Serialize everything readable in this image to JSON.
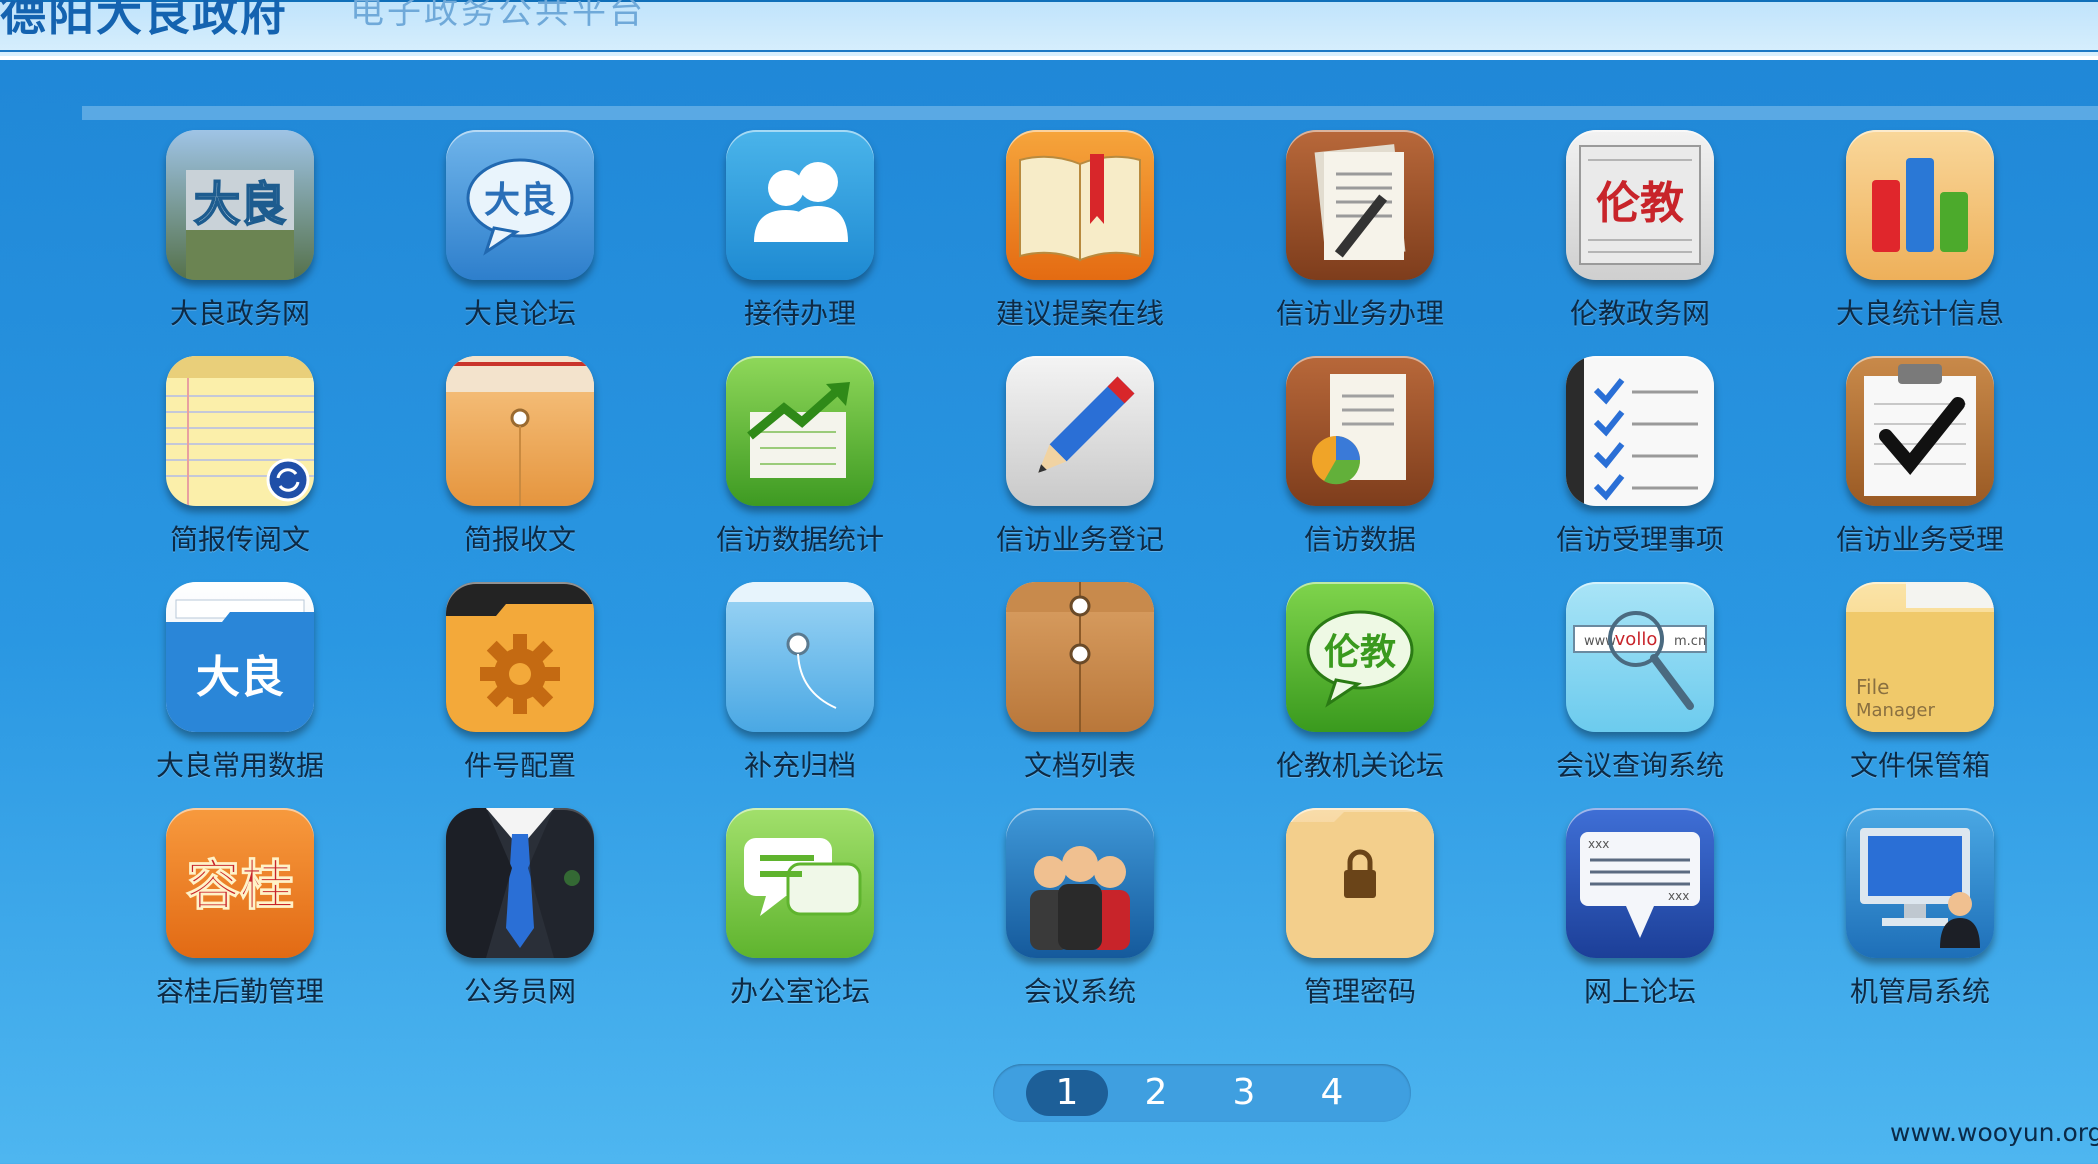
{
  "header": {
    "title": "德阳大良政府",
    "subtitle": "电子政务公共平台"
  },
  "apps": [
    {
      "label": "大良政务网",
      "icon": "daliang-building-icon"
    },
    {
      "label": "大良论坛",
      "icon": "daliang-chat-bubble-icon"
    },
    {
      "label": "接待办理",
      "icon": "users-icon"
    },
    {
      "label": "建议提案在线",
      "icon": "open-book-icon"
    },
    {
      "label": "信访业务办理",
      "icon": "document-pen-icon"
    },
    {
      "label": "伦教政务网",
      "icon": "lunjiao-newspaper-icon"
    },
    {
      "label": "大良统计信息",
      "icon": "bar-chart-icon"
    },
    {
      "label": "简报传阅文",
      "icon": "notepad-sync-icon"
    },
    {
      "label": "简报收文",
      "icon": "envelope-folder-icon"
    },
    {
      "label": "信访数据统计",
      "icon": "trend-chart-icon"
    },
    {
      "label": "信访业务登记",
      "icon": "pencil-icon"
    },
    {
      "label": "信访数据",
      "icon": "document-pie-icon"
    },
    {
      "label": "信访受理事项",
      "icon": "checklist-icon"
    },
    {
      "label": "信访业务受理",
      "icon": "clipboard-check-icon"
    },
    {
      "label": "大良常用数据",
      "icon": "daliang-folder-icon"
    },
    {
      "label": "件号配置",
      "icon": "gear-folder-icon"
    },
    {
      "label": "补充归档",
      "icon": "blue-file-folder-icon"
    },
    {
      "label": "文档列表",
      "icon": "string-envelope-icon"
    },
    {
      "label": "伦教机关论坛",
      "icon": "lunjiao-chat-bubble-icon"
    },
    {
      "label": "会议查询系统",
      "icon": "magnifier-url-icon"
    },
    {
      "label": "文件保管箱",
      "icon": "file-manager-folder-icon"
    },
    {
      "label": "容桂后勤管理",
      "icon": "ronggui-badge-icon"
    },
    {
      "label": "公务员网",
      "icon": "suit-tie-icon"
    },
    {
      "label": "办公室论坛",
      "icon": "green-chat-icon"
    },
    {
      "label": "会议系统",
      "icon": "meeting-people-icon"
    },
    {
      "label": "管理密码",
      "icon": "locked-folder-icon"
    },
    {
      "label": "网上论坛",
      "icon": "speech-card-icon"
    },
    {
      "label": "机管局系统",
      "icon": "computer-user-icon"
    }
  ],
  "icon_text": {
    "daliang": "大良",
    "lunjiao": "伦教",
    "ronggui": "容桂",
    "file_manager_1": "File",
    "file_manager_2": "Manager",
    "url_left": "www",
    "url_mid": "vollo",
    "url_right": "m.cn",
    "xxx": "xxx"
  },
  "pager": {
    "pages": [
      "1",
      "2",
      "3",
      "4"
    ],
    "current": "1"
  },
  "watermark": "www.wooyun.org",
  "colors": {
    "background": "#2a97e2",
    "pager_active": "#1d5f98",
    "label_text": "#0d2a45"
  }
}
